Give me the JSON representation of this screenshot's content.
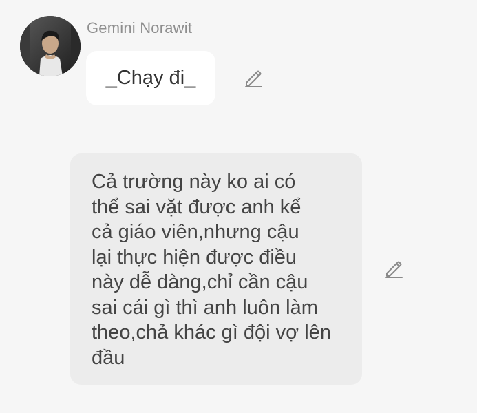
{
  "sender": {
    "name": "Gemini Norawit"
  },
  "messages": [
    {
      "text": "_Chạy đi_"
    },
    {
      "lines": [
        "Cả trường này ko ai có",
        "thể sai vặt được anh kể",
        "cả giáo viên,nhưng cậu",
        "lại thực hiện được điều",
        "này dễ dàng,chỉ cần cậu",
        "sai cái gì thì anh luôn làm",
        "theo,chả khác gì đội vợ lên",
        "đầu"
      ]
    }
  ],
  "icons": {
    "edit": "pencil-edit-icon"
  },
  "colors": {
    "background": "#f6f6f6",
    "bubble_white": "#ffffff",
    "bubble_grey": "#ececec",
    "name_text": "#8e8e8e",
    "icon": "#8a8a8a"
  }
}
